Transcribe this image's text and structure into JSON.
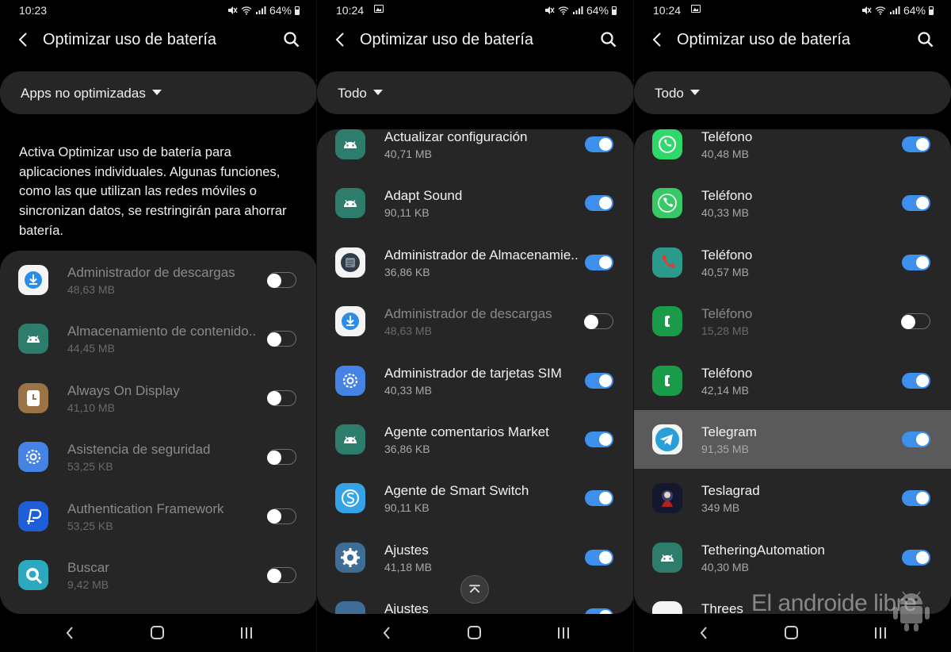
{
  "screens": [
    {
      "status": {
        "time": "10:23",
        "battery": "64%"
      },
      "header": {
        "title": "Optimizar uso de batería"
      },
      "filter": {
        "label": "Apps no optimizadas"
      },
      "description": "Activa Optimizar uso de batería para aplicaciones individuales. Algunas funciones, como las que utilizan las redes móviles o sincronizan datos, se restringirán para ahorrar batería.",
      "apps": [
        {
          "name": "Administrador de descargas",
          "size": "48,63 MB",
          "enabled": false,
          "icon": "download-icon"
        },
        {
          "name": "Almacenamiento de contenido..",
          "size": "44,45 MB",
          "enabled": false,
          "icon": "android-icon"
        },
        {
          "name": "Always On Display",
          "size": "41,10 MB",
          "enabled": false,
          "icon": "clock-icon"
        },
        {
          "name": "Asistencia de seguridad",
          "size": "53,25 KB",
          "enabled": false,
          "icon": "gear-icon"
        },
        {
          "name": "Authentication Framework",
          "size": "53,25 KB",
          "enabled": false,
          "icon": "paypal-icon"
        },
        {
          "name": "Buscar",
          "size": "9,42 MB",
          "enabled": false,
          "icon": "search-app-icon"
        }
      ]
    },
    {
      "status": {
        "time": "10:24",
        "battery": "64%"
      },
      "header": {
        "title": "Optimizar uso de batería"
      },
      "filter": {
        "label": "Todo"
      },
      "apps": [
        {
          "name": "Actualizar configuración",
          "size": "40,71 MB",
          "enabled": true,
          "icon": "android-icon"
        },
        {
          "name": "Adapt Sound",
          "size": "90,11 KB",
          "enabled": true,
          "icon": "android-icon"
        },
        {
          "name": "Administrador de Almacenamie..",
          "size": "36,86 KB",
          "enabled": true,
          "icon": "storage-icon"
        },
        {
          "name": "Administrador de descargas",
          "size": "48,63 MB",
          "enabled": false,
          "icon": "download-icon"
        },
        {
          "name": "Administrador de tarjetas SIM",
          "size": "40,33 MB",
          "enabled": true,
          "icon": "gear-icon"
        },
        {
          "name": "Agente comentarios Market",
          "size": "36,86 KB",
          "enabled": true,
          "icon": "android-icon"
        },
        {
          "name": "Agente de Smart Switch",
          "size": "90,11 KB",
          "enabled": true,
          "icon": "smart-switch-icon"
        },
        {
          "name": "Ajustes",
          "size": "41,18 MB",
          "enabled": true,
          "icon": "settings-icon"
        },
        {
          "name": "Ajustes",
          "size": "",
          "enabled": true,
          "icon": "settings-icon"
        }
      ]
    },
    {
      "status": {
        "time": "10:24",
        "battery": "64%"
      },
      "header": {
        "title": "Optimizar uso de batería"
      },
      "filter": {
        "label": "Todo"
      },
      "apps": [
        {
          "name": "Teléfono",
          "size": "40,48 MB",
          "enabled": true,
          "icon": "whatsapp-phone-icon"
        },
        {
          "name": "Teléfono",
          "size": "40,33 MB",
          "enabled": true,
          "icon": "phone-icon"
        },
        {
          "name": "Teléfono",
          "size": "40,57 MB",
          "enabled": true,
          "icon": "phone-icon"
        },
        {
          "name": "Teléfono",
          "size": "15,28 MB",
          "enabled": false,
          "icon": "phone-icon"
        },
        {
          "name": "Teléfono",
          "size": "42,14 MB",
          "enabled": true,
          "icon": "phone-icon"
        },
        {
          "name": "Telegram",
          "size": "91,35 MB",
          "enabled": true,
          "icon": "telegram-icon",
          "highlighted": true
        },
        {
          "name": "Teslagrad",
          "size": "349 MB",
          "enabled": true,
          "icon": "game-icon"
        },
        {
          "name": "TetheringAutomation",
          "size": "40,30 MB",
          "enabled": true,
          "icon": "android-icon"
        },
        {
          "name": "Threes",
          "size": "",
          "enabled": true,
          "icon": "game-icon"
        }
      ]
    }
  ],
  "watermark": "El androide libre",
  "colors": {
    "accent": "#3e91ea",
    "panel": "#262626",
    "background": "#000000",
    "highlight": "#5a5a5a"
  }
}
